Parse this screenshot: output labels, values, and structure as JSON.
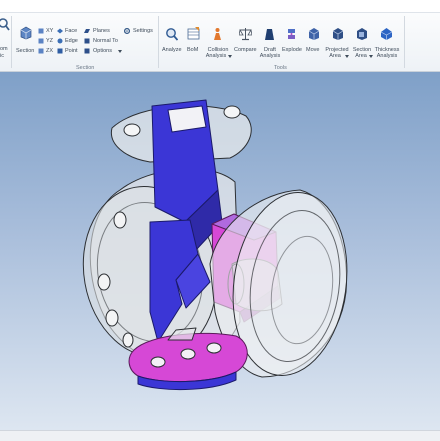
{
  "ribbon": {
    "left_cut_labels": [
      "om",
      "ic"
    ],
    "section": {
      "section_button": "Section",
      "xy": "XY",
      "yz": "YZ",
      "zx": "ZX",
      "face": "Face",
      "edge": "Edge",
      "point": "Point",
      "planes": "Planes",
      "normal_to": "Normal To",
      "options": "Options",
      "settings": "Settings",
      "group_label": "Section"
    },
    "tools": {
      "analyze": "Analyze",
      "bom": "BoM",
      "collision_l1": "Collision",
      "collision_l2": "Analysis",
      "compare": "Compare",
      "draft_l1": "Draft",
      "draft_l2": "Analysis",
      "explode": "Explode",
      "move": "Move",
      "projected_l1": "Projected",
      "projected_l2": "Area",
      "section_area_l1": "Section",
      "section_area_l2": "Area",
      "thickness_l1": "Thickness",
      "thickness_l2": "Analysis",
      "group_label": "Tools"
    }
  },
  "colors": {
    "ribbon_bg": "#eef2f6",
    "viewport_top": "#7fa0c8",
    "viewport_bottom": "#dde6f1",
    "part_blue": "#3a36d8",
    "part_magenta": "#d84fd8",
    "housing_fill": "#e4e7ea"
  }
}
